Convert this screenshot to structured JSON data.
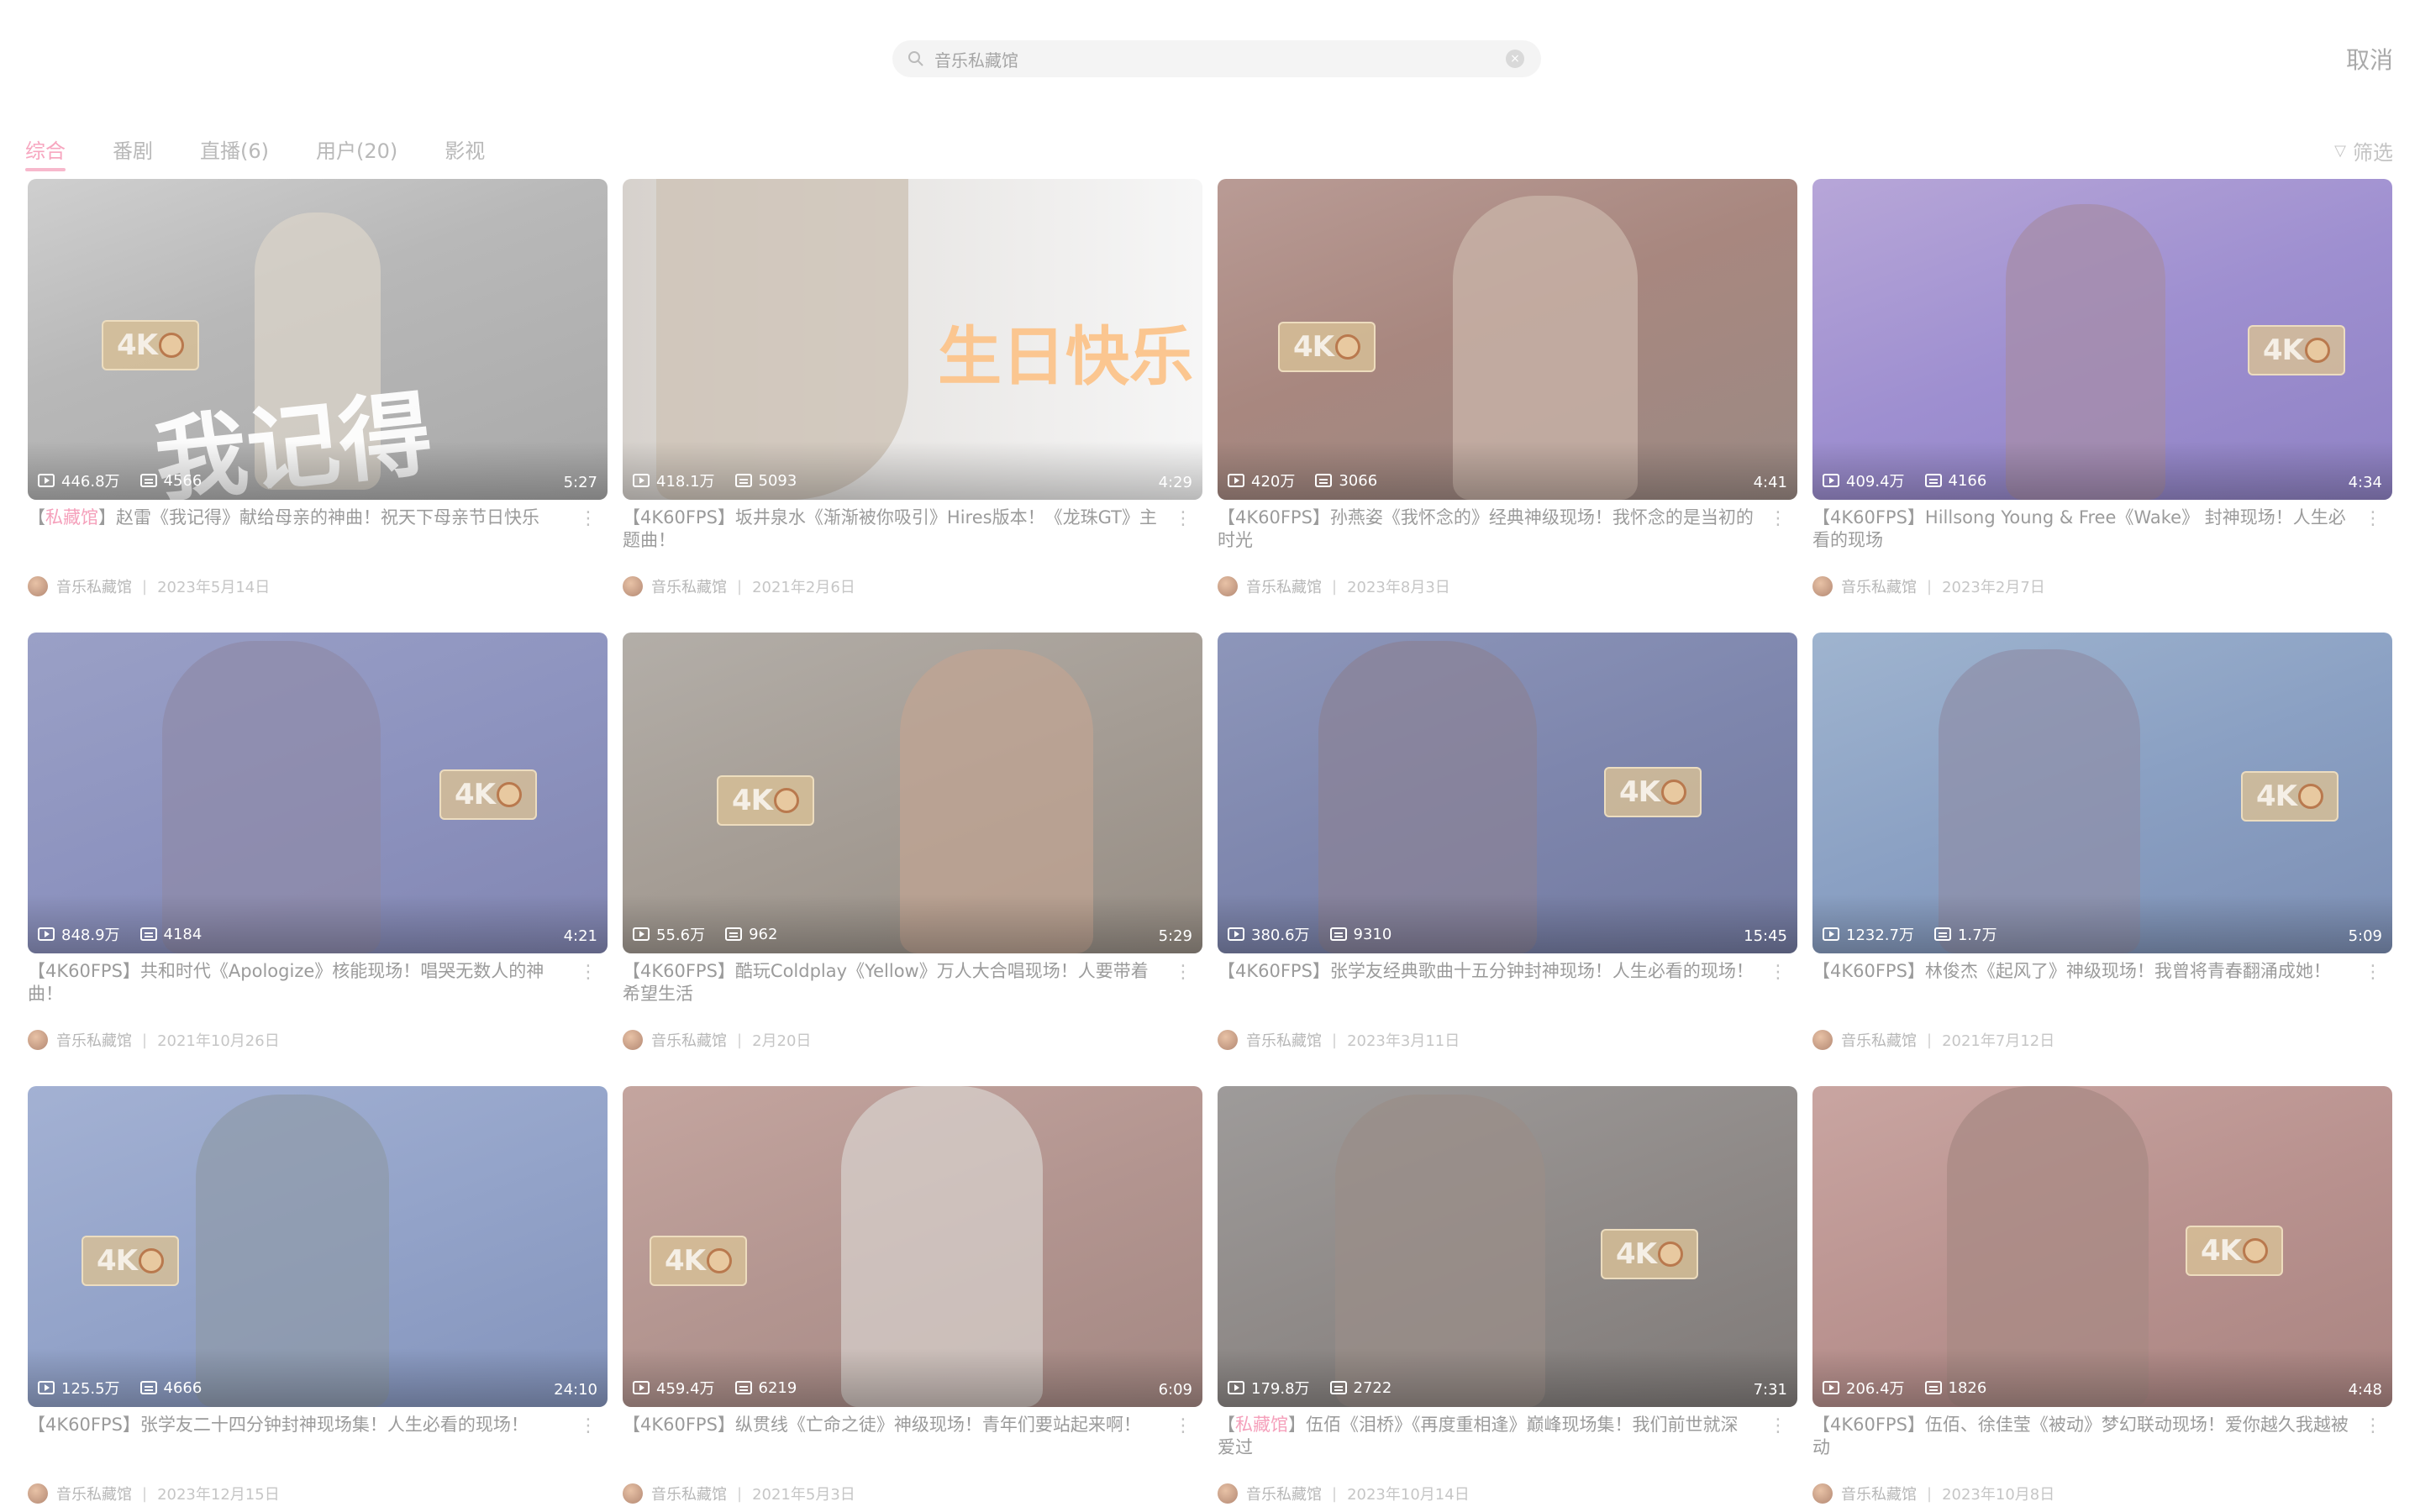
{
  "search": {
    "value": "音乐私藏馆",
    "cancel_label": "取消"
  },
  "tabs": [
    {
      "label": "综合",
      "active": true
    },
    {
      "label": "番剧",
      "active": false
    },
    {
      "label": "直播(6)",
      "active": false
    },
    {
      "label": "用户(20)",
      "active": false
    },
    {
      "label": "影视",
      "active": false
    }
  ],
  "filter_label": "筛选",
  "videos": [
    {
      "views": "446.8万",
      "danmaku": "4566",
      "duration": "5:27",
      "title_highlight": "私藏馆",
      "title_prefix": "【",
      "title_rest": "】赵雷《我记得》献给母亲的神曲！祝天下母亲节日快乐",
      "uploader": "音乐私藏馆",
      "date": "2023年5月14日",
      "overlay_text": "我记得"
    },
    {
      "views": "418.1万",
      "danmaku": "5093",
      "duration": "4:29",
      "title_highlight": "",
      "title_prefix": "",
      "title_rest": "【4K60FPS】坂井泉水《渐渐被你吸引》Hires版本！《龙珠GT》主题曲！",
      "uploader": "音乐私藏馆",
      "date": "2021年2月6日",
      "overlay_text": "生日快乐"
    },
    {
      "views": "420万",
      "danmaku": "3066",
      "duration": "4:41",
      "title_highlight": "",
      "title_prefix": "",
      "title_rest": "【4K60FPS】孙燕姿《我怀念的》经典神级现场！我怀念的是当初的时光",
      "uploader": "音乐私藏馆",
      "date": "2023年8月3日",
      "overlay_text": ""
    },
    {
      "views": "409.4万",
      "danmaku": "4166",
      "duration": "4:34",
      "title_highlight": "",
      "title_prefix": "",
      "title_rest": "【4K60FPS】Hillsong Young & Free《Wake》 封神现场！人生必看的现场",
      "uploader": "音乐私藏馆",
      "date": "2023年2月7日",
      "overlay_text": ""
    },
    {
      "views": "848.9万",
      "danmaku": "4184",
      "duration": "4:21",
      "title_highlight": "",
      "title_prefix": "",
      "title_rest": "【4K60FPS】共和时代《Apologize》核能现场！唱哭无数人的神曲！",
      "uploader": "音乐私藏馆",
      "date": "2021年10月26日",
      "overlay_text": ""
    },
    {
      "views": "55.6万",
      "danmaku": "962",
      "duration": "5:29",
      "title_highlight": "",
      "title_prefix": "",
      "title_rest": "【4K60FPS】酷玩Coldplay《Yellow》万人大合唱现场！人要带着希望生活",
      "uploader": "音乐私藏馆",
      "date": "2月20日",
      "overlay_text": ""
    },
    {
      "views": "380.6万",
      "danmaku": "9310",
      "duration": "15:45",
      "title_highlight": "",
      "title_prefix": "",
      "title_rest": "【4K60FPS】张学友经典歌曲十五分钟封神现场！人生必看的现场！",
      "uploader": "音乐私藏馆",
      "date": "2023年3月11日",
      "overlay_text": ""
    },
    {
      "views": "1232.7万",
      "danmaku": "1.7万",
      "duration": "5:09",
      "title_highlight": "",
      "title_prefix": "",
      "title_rest": "【4K60FPS】林俊杰《起风了》神级现场！我曾将青春翻涌成她！",
      "uploader": "音乐私藏馆",
      "date": "2021年7月12日",
      "overlay_text": ""
    },
    {
      "views": "125.5万",
      "danmaku": "4666",
      "duration": "24:10",
      "title_highlight": "",
      "title_prefix": "",
      "title_rest": "【4K60FPS】张学友二十四分钟封神现场集！人生必看的现场！",
      "uploader": "音乐私藏馆",
      "date": "2023年12月15日",
      "overlay_text": ""
    },
    {
      "views": "459.4万",
      "danmaku": "6219",
      "duration": "6:09",
      "title_highlight": "",
      "title_prefix": "",
      "title_rest": "【4K60FPS】纵贯线《亡命之徒》神级现场！青年们要站起来啊！",
      "uploader": "音乐私藏馆",
      "date": "2021年5月3日",
      "overlay_text": ""
    },
    {
      "views": "179.8万",
      "danmaku": "2722",
      "duration": "7:31",
      "title_highlight": "私藏馆",
      "title_prefix": "【",
      "title_rest": "】伍佰《泪桥》《再度重相逢》巅峰现场集！我们前世就深爱过",
      "uploader": "音乐私藏馆",
      "date": "2023年10月14日",
      "overlay_text": ""
    },
    {
      "views": "206.4万",
      "danmaku": "1826",
      "duration": "4:48",
      "title_highlight": "",
      "title_prefix": "",
      "title_rest": "【4K60FPS】伍佰、徐佳莹《被动》梦幻联动现场！爱你越久我越被动",
      "uploader": "音乐私藏馆",
      "date": "2023年10月8日",
      "overlay_text": ""
    }
  ],
  "badge_text": "4K"
}
